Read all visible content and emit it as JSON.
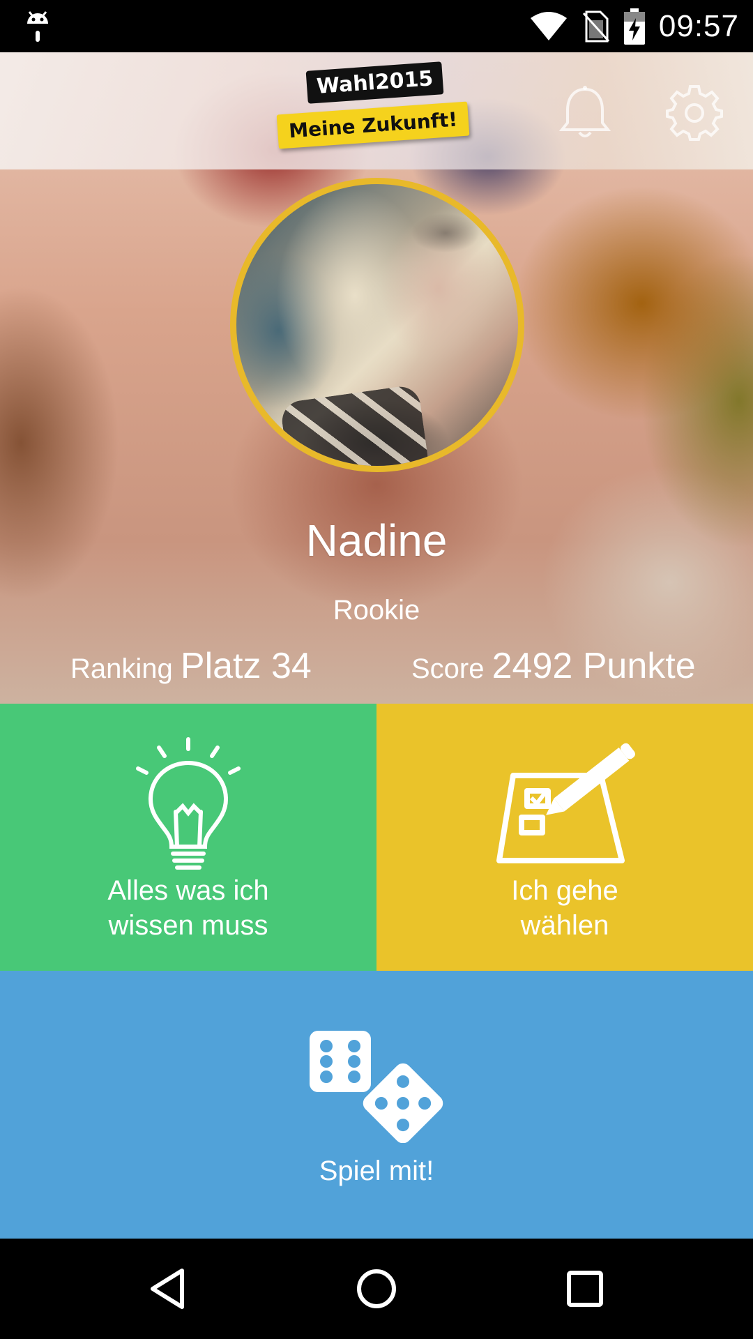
{
  "status_bar": {
    "time": "09:57",
    "icons": [
      "android-debug-icon",
      "wifi-icon",
      "no-sim-icon",
      "battery-charging-icon"
    ]
  },
  "header": {
    "logo_line1": "Wahl2015",
    "logo_line2": "Meine Zukunft!",
    "notification_icon": "bell-icon",
    "settings_icon": "gear-icon"
  },
  "profile": {
    "name": "Nadine",
    "rank_title": "Rookie",
    "ranking_label": "Ranking",
    "ranking_value": "Platz 34",
    "score_label": "Score",
    "score_value": "2492 Punkte",
    "accent_color": "#e8b92a"
  },
  "tiles": {
    "knowledge": {
      "line1": "Alles was ich",
      "line2": "wissen muss",
      "icon": "lightbulb-icon",
      "color": "#48c877"
    },
    "vote": {
      "line1": "Ich gehe",
      "line2": "wählen",
      "icon": "ballot-pencil-icon",
      "color": "#eac32a"
    },
    "game": {
      "label": "Spiel mit!",
      "icon": "dice-icon",
      "color": "#51a2d9"
    }
  },
  "nav_bar": {
    "back_icon": "back-triangle-icon",
    "home_icon": "home-circle-icon",
    "recents_icon": "recents-square-icon"
  }
}
